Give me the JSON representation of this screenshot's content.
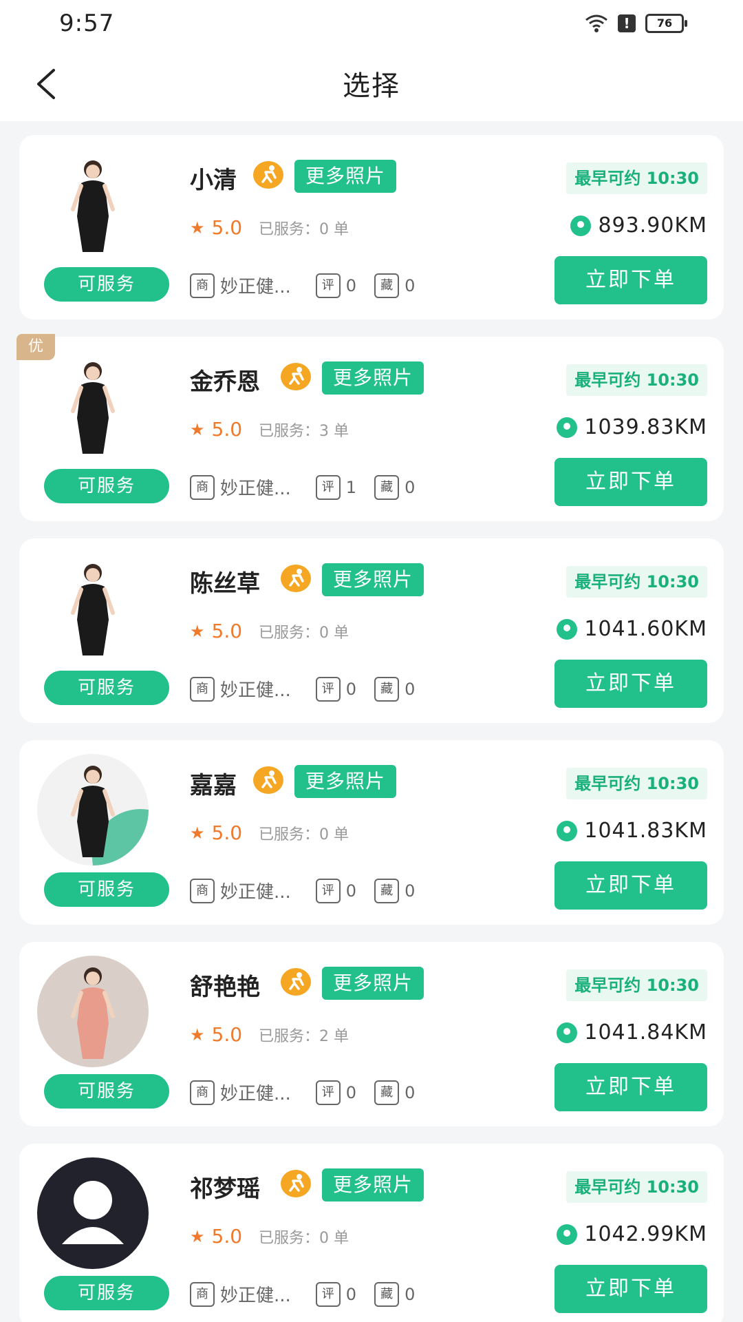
{
  "status": {
    "time": "9:57",
    "battery": "76",
    "alert": "!"
  },
  "nav": {
    "title": "选择"
  },
  "cards": [
    {
      "badge": "",
      "name": "小清",
      "photos": "更多照片",
      "rating": "5.0",
      "served": "已服务：0 单",
      "shop": "妙正健...",
      "shop_icon": "商",
      "review_icon": "评",
      "reviews": "0",
      "fav_icon": "藏",
      "favs": "0",
      "status": "可服务",
      "earliest": "最早可约 10:30",
      "distance": "893.90KM",
      "order": "立即下单",
      "avatar_type": "photo-black"
    },
    {
      "badge": "优",
      "name": "金乔恩",
      "photos": "更多照片",
      "rating": "5.0",
      "served": "已服务：3 单",
      "shop": "妙正健...",
      "shop_icon": "商",
      "review_icon": "评",
      "reviews": "1",
      "fav_icon": "藏",
      "favs": "0",
      "status": "可服务",
      "earliest": "最早可约 10:30",
      "distance": "1039.83KM",
      "order": "立即下单",
      "avatar_type": "photo-black"
    },
    {
      "badge": "",
      "name": "陈丝草",
      "photos": "更多照片",
      "rating": "5.0",
      "served": "已服务：0 单",
      "shop": "妙正健...",
      "shop_icon": "商",
      "review_icon": "评",
      "reviews": "0",
      "fav_icon": "藏",
      "favs": "0",
      "status": "可服务",
      "earliest": "最早可约 10:30",
      "distance": "1041.60KM",
      "order": "立即下单",
      "avatar_type": "photo-black"
    },
    {
      "badge": "",
      "name": "嘉嘉",
      "photos": "更多照片",
      "rating": "5.0",
      "served": "已服务：0 单",
      "shop": "妙正健...",
      "shop_icon": "商",
      "review_icon": "评",
      "reviews": "0",
      "fav_icon": "藏",
      "favs": "0",
      "status": "可服务",
      "earliest": "最早可约 10:30",
      "distance": "1041.83KM",
      "order": "立即下单",
      "avatar_type": "photo-green"
    },
    {
      "badge": "",
      "name": "舒艳艳",
      "photos": "更多照片",
      "rating": "5.0",
      "served": "已服务：2 单",
      "shop": "妙正健...",
      "shop_icon": "商",
      "review_icon": "评",
      "reviews": "0",
      "fav_icon": "藏",
      "favs": "0",
      "status": "可服务",
      "earliest": "最早可约 10:30",
      "distance": "1041.84KM",
      "order": "立即下单",
      "avatar_type": "photo-pink"
    },
    {
      "badge": "",
      "name": "祁梦瑶",
      "photos": "更多照片",
      "rating": "5.0",
      "served": "已服务：0 单",
      "shop": "妙正健...",
      "shop_icon": "商",
      "review_icon": "评",
      "reviews": "0",
      "fav_icon": "藏",
      "favs": "0",
      "status": "可服务",
      "earliest": "最早可约 10:30",
      "distance": "1042.99KM",
      "order": "立即下单",
      "avatar_type": "default-user"
    }
  ],
  "colors": {
    "accent": "#22c08a",
    "rating": "#f07a2a",
    "badge": "#d9b58c",
    "runner": "#f5a623"
  }
}
